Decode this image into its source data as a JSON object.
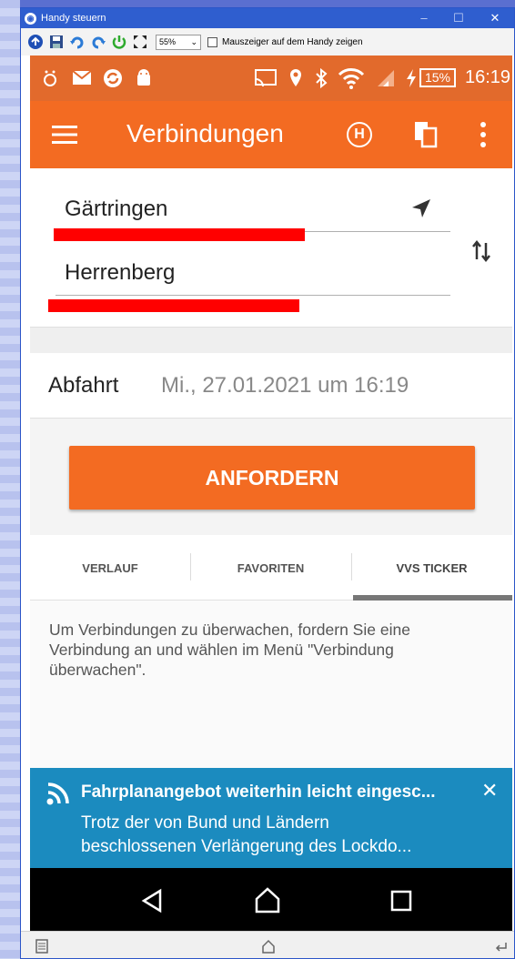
{
  "window": {
    "title": "Handy steuern",
    "minimize_glyph": "–",
    "maximize_glyph": "☐",
    "close_glyph": "✕"
  },
  "toolbar": {
    "zoom": "55%",
    "mouse_pointer_label": "Mauszeiger auf dem Handy zeigen",
    "mouse_pointer_checked": false
  },
  "statusbar": {
    "battery": "15%",
    "time": "16:19"
  },
  "appbar": {
    "title": "Verbindungen",
    "stop_icon_label": "H"
  },
  "form": {
    "from": "Gärtringen",
    "to": "Herrenberg",
    "departure_label": "Abfahrt",
    "departure_value": "Mi., 27.01.2021 um 16:19",
    "request_button": "ANFORDERN"
  },
  "tabs": [
    {
      "label": "VERLAUF",
      "active": false
    },
    {
      "label": "FAVORITEN",
      "active": false
    },
    {
      "label": "VVS TICKER",
      "active": true
    }
  ],
  "info_text": "Um Verbindungen zu überwachen, fordern Sie eine Verbindung an und wählen im Menü \"Verbindung überwachen\".",
  "news": {
    "title": "Fahrplanangebot weiterhin leicht eingesc...",
    "body_line1": "Trotz der von Bund und Ländern",
    "body_line2": "beschlossenen Verlängerung des Lockdo...",
    "close_glyph": "✕"
  },
  "colors": {
    "accent": "#f36b22",
    "news_bg": "#1b8bbf",
    "titlebar": "#2f5ecf"
  }
}
